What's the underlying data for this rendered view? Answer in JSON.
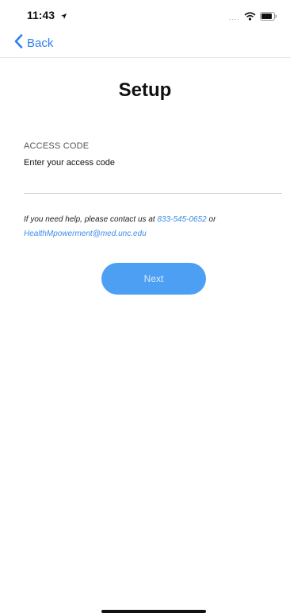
{
  "status_bar": {
    "time": "11:43",
    "signal_dots": "....",
    "icons": [
      "location-arrow-icon",
      "wifi-icon",
      "battery-icon"
    ]
  },
  "nav": {
    "back_label": "Back",
    "back_icon": "chevron-left-icon"
  },
  "page": {
    "title": "Setup"
  },
  "access_code": {
    "label": "ACCESS CODE",
    "placeholder": "Enter your access code",
    "value": ""
  },
  "help": {
    "text_before": "If you need help, please contact us at ",
    "phone": "833-545-0652",
    "text_middle": " or",
    "email": "HealthMpowerment@med.unc.edu"
  },
  "actions": {
    "next_label": "Next"
  },
  "colors": {
    "accent": "#2f7ff0",
    "link": "#3b8bea",
    "button_bg": "#4c9ff2",
    "button_text": "#d8ebff"
  }
}
